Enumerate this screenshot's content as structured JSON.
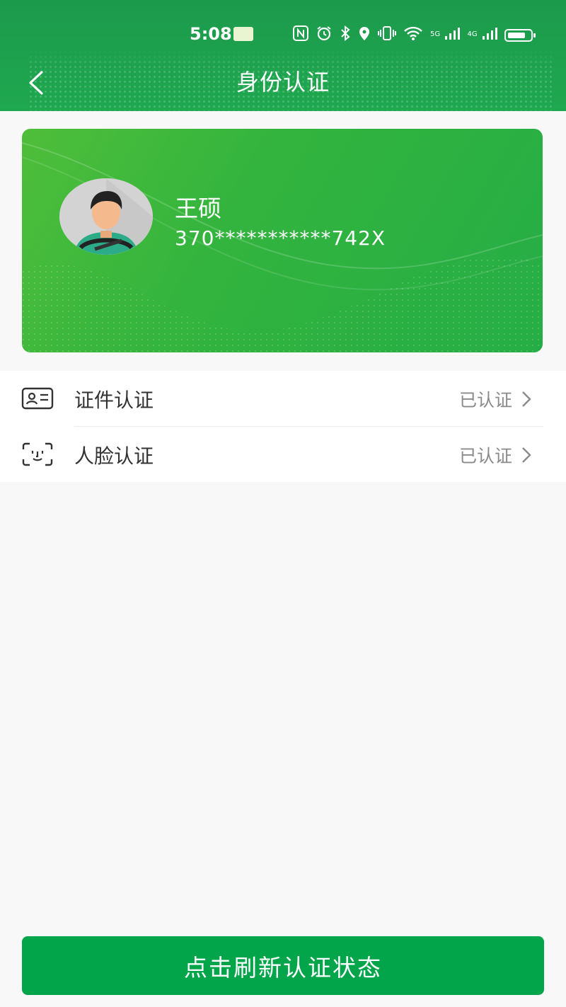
{
  "status_bar": {
    "time": "5:08",
    "icons": [
      "nfc-icon",
      "alarm-icon",
      "bluetooth-icon",
      "location-icon",
      "vibrate-icon",
      "wifi-icon",
      "5g-signal-icon",
      "4g-signal-icon",
      "battery-icon"
    ],
    "net1": "5G",
    "net2": "4G"
  },
  "header": {
    "title": "身份认证",
    "back_icon": "chevron-left-icon"
  },
  "profile": {
    "name": "王硕",
    "id_number": "370***********742X",
    "avatar_icon": "driver-avatar-icon"
  },
  "verifications": [
    {
      "label": "证件认证",
      "status": "已认证",
      "icon": "id-card-icon"
    },
    {
      "label": "人脸认证",
      "status": "已认证",
      "icon": "face-scan-icon"
    }
  ],
  "refresh_button": {
    "label": "点击刷新认证状态"
  },
  "colors": {
    "brand_green": "#1fa84f",
    "button_green": "#03a54b",
    "status_gray": "#8a8a8a"
  }
}
